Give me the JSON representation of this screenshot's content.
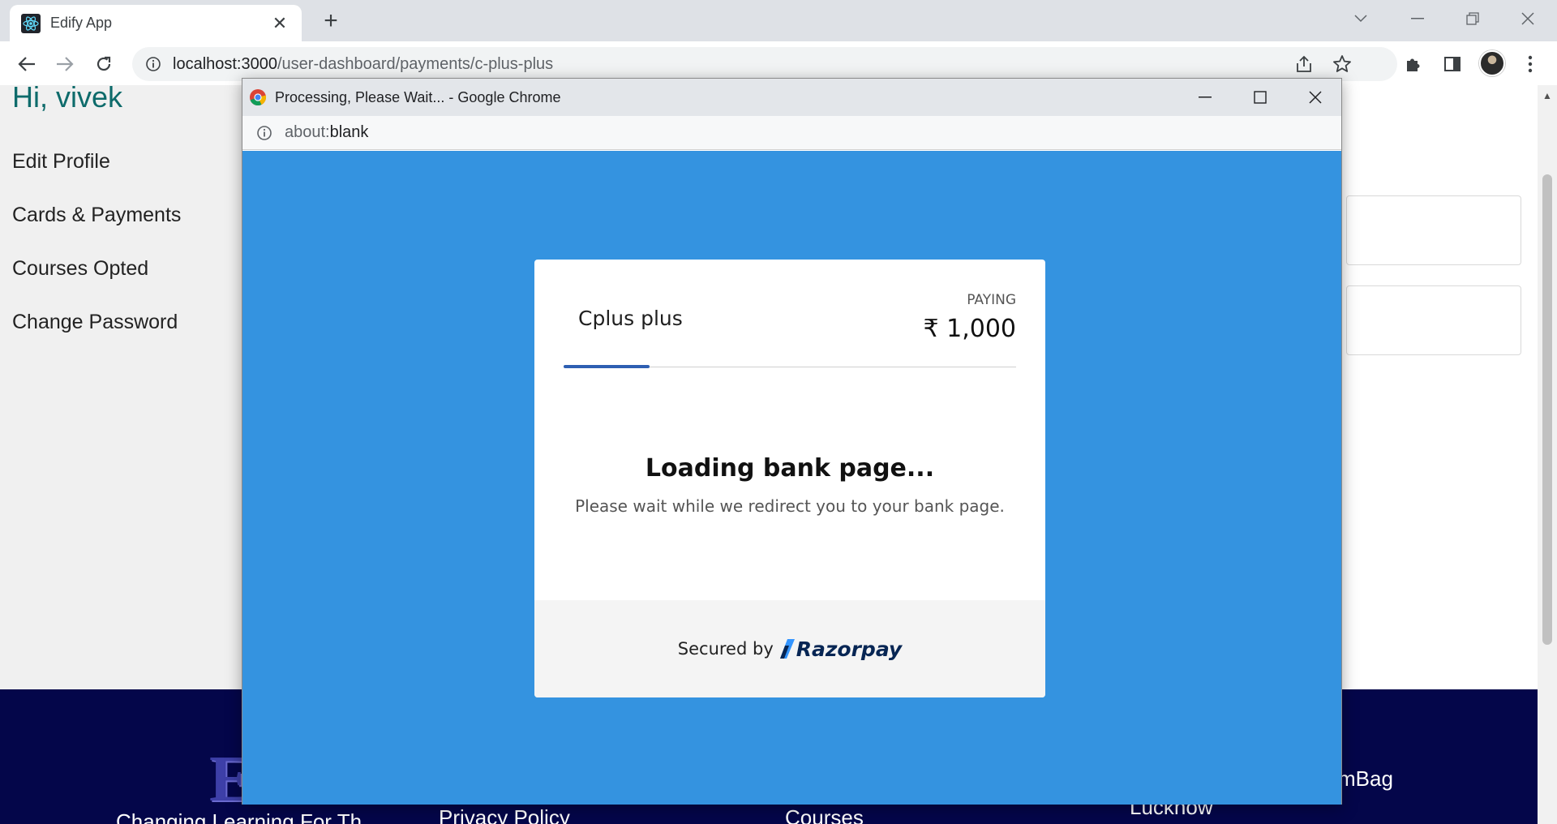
{
  "browser": {
    "tab_title": "Edify App",
    "url_host": "localhost:3000",
    "url_path": "/user-dashboard/payments/c-plus-plus"
  },
  "page": {
    "greeting": "Hi, vivek",
    "sidebar": [
      {
        "label": "Edit Profile"
      },
      {
        "label": "Cards & Payments"
      },
      {
        "label": "Courses Opted"
      },
      {
        "label": "Change Password"
      }
    ],
    "footer": {
      "logo_letter": "E",
      "tagline_partial": "Changing Learning For Th",
      "link_privacy": "Privacy Policy",
      "link_courses": "Courses",
      "city": "Lucknow",
      "brand_partial": "mBag"
    }
  },
  "popup": {
    "window_title": "Processing, Please Wait... - Google Chrome",
    "url_scheme": "about:",
    "url_main": "blank",
    "background_color": "#3493e0",
    "card": {
      "merchant": "Cplus plus",
      "paying_label": "PAYING",
      "amount": "₹ 1,000",
      "loading_progress": 0.19,
      "loading_title": "Loading bank page...",
      "loading_desc": "Please wait while we redirect you to your bank page.",
      "secured_by": "Secured by",
      "brand": "Razorpay"
    }
  }
}
